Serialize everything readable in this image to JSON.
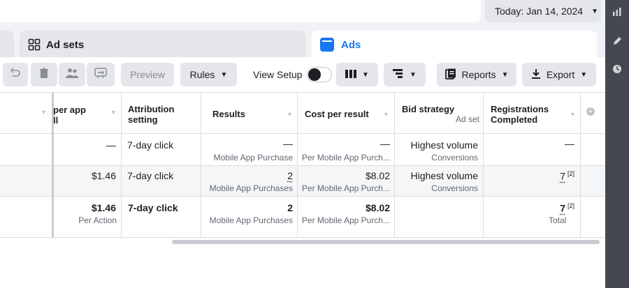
{
  "date_picker": {
    "label": "Today: Jan 14, 2024"
  },
  "tabs": {
    "ad_sets": {
      "label": "Ad sets"
    },
    "ads": {
      "label": "Ads"
    }
  },
  "toolbar": {
    "preview_label": "Preview",
    "rules_label": "Rules",
    "view_setup_label": "View Setup",
    "reports_label": "Reports",
    "export_label": "Export"
  },
  "table": {
    "columns": [
      {
        "label": "per app\nll"
      },
      {
        "label": "Attribution setting"
      },
      {
        "label": "Results"
      },
      {
        "label": "Cost per result"
      },
      {
        "label": "Bid strategy",
        "sub": "Ad set"
      },
      {
        "label": "Registrations Completed"
      }
    ],
    "rows": [
      {
        "per_app": "—",
        "attribution": "7-day click",
        "results": "—",
        "results_sub": "Mobile App Purchase",
        "cost": "—",
        "cost_sub": "Per Mobile App Purch...",
        "bid": "Highest volume",
        "bid_sub": "Conversions",
        "registrations": "—"
      },
      {
        "per_app": "$1.46",
        "attribution": "7-day click",
        "results": "2",
        "results_sub": "Mobile App Purchases",
        "cost": "$8.02",
        "cost_sub": "Per Mobile App Purch...",
        "bid": "Highest volume",
        "bid_sub": "Conversions",
        "registrations": "7",
        "registrations_note": "[2]"
      }
    ],
    "total": {
      "per_app": "$1.46",
      "per_app_sub": "Per Action",
      "attribution": "7-day click",
      "results": "2",
      "results_sub": "Mobile App Purchases",
      "cost": "$8.02",
      "cost_sub": "Per Mobile App Purch...",
      "registrations": "7",
      "registrations_note": "[2]",
      "registrations_sub": "Total"
    }
  }
}
